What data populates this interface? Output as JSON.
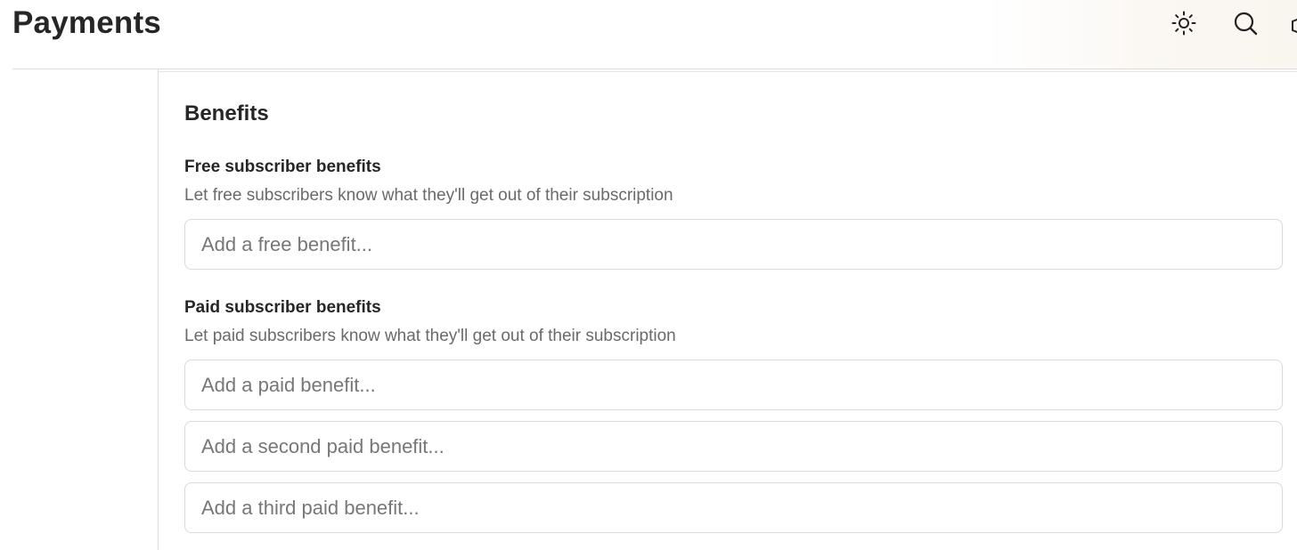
{
  "header": {
    "title": "Payments",
    "icons": {
      "theme": "sun-icon",
      "search": "search-icon"
    }
  },
  "benefits": {
    "title": "Benefits",
    "free": {
      "label": "Free subscriber benefits",
      "description": "Let free subscribers know what they'll get out of their subscription",
      "inputs": [
        {
          "placeholder": "Add a free benefit...",
          "value": ""
        }
      ]
    },
    "paid": {
      "label": "Paid subscriber benefits",
      "description": "Let paid subscribers know what they'll get out of their subscription",
      "inputs": [
        {
          "placeholder": "Add a paid benefit...",
          "value": ""
        },
        {
          "placeholder": "Add a second paid benefit...",
          "value": ""
        },
        {
          "placeholder": "Add a third paid benefit...",
          "value": ""
        }
      ]
    }
  }
}
